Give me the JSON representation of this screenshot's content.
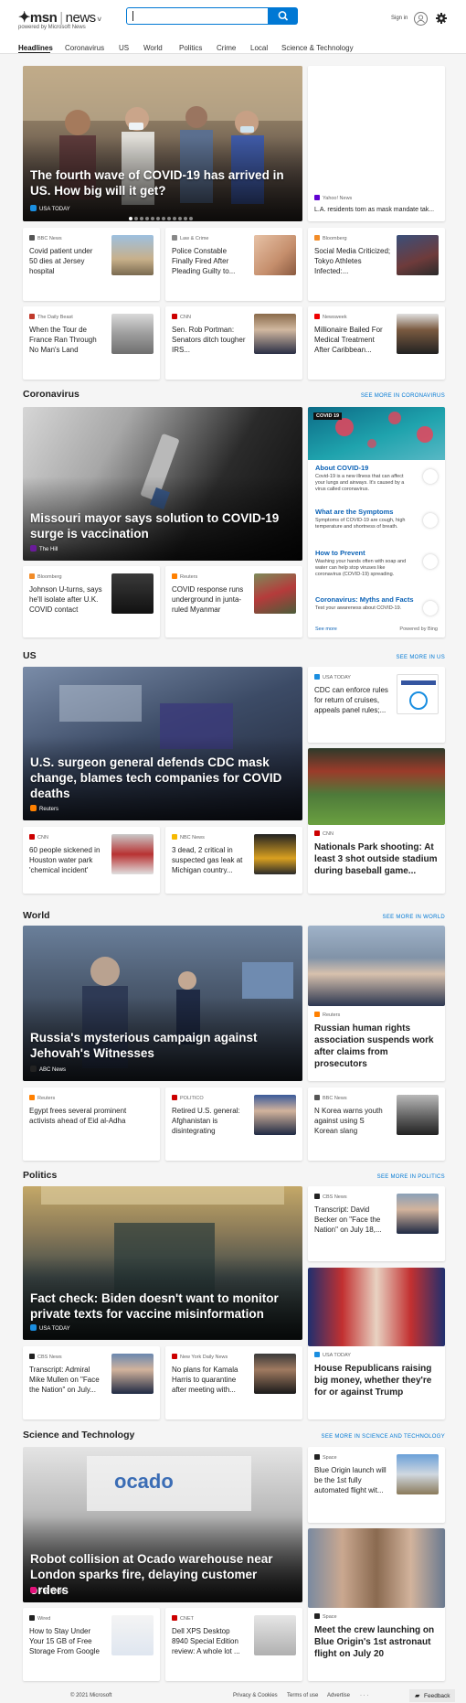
{
  "header": {
    "logo_msn": "msn",
    "logo_news": "news",
    "powered": "powered by Microsoft News",
    "search_value": "",
    "signin": "Sign in"
  },
  "nav": [
    "Headlines",
    "Coronavirus",
    "US",
    "World",
    "Politics",
    "Crime",
    "Local",
    "Science & Technology"
  ],
  "top": {
    "hero": {
      "title": "The fourth wave of COVID-19 has arrived in US. How big will it get?",
      "source": "USA TODAY"
    },
    "side": {
      "source": "Yahoo! News",
      "title": "L.A. residents torn as mask mandate tak..."
    },
    "row1": [
      {
        "source": "BBC News",
        "title": "Covid patient under 50 dies at Jersey hospital"
      },
      {
        "source": "Law & Crime",
        "title": "Police Constable Finally Fired After Pleading Guilty to..."
      },
      {
        "source": "Bloomberg",
        "title": "Social Media Criticized; Tokyo Athletes Infected:..."
      }
    ],
    "row2": [
      {
        "source": "The Daily Beast",
        "title": "When the Tour de France Ran Through No Man's Land"
      },
      {
        "source": "CNN",
        "title": "Sen. Rob Portman: Senators ditch tougher IRS..."
      },
      {
        "source": "Newsweek",
        "title": "Millionaire Bailed For Medical Treatment After Caribbean..."
      }
    ]
  },
  "coronavirus": {
    "heading": "Coronavirus",
    "more": "SEE MORE IN CORONAVIRUS",
    "hero": {
      "title": "Missouri mayor says solution to COVID-19 surge is vaccination",
      "source": "The Hill"
    },
    "row": [
      {
        "source": "Bloomberg",
        "title": "Johnson U-turns, says he'll isolate after U.K. COVID contact"
      },
      {
        "source": "Reuters",
        "title": "COVID response runs underground in junta-ruled Myanmar"
      }
    ],
    "panel": {
      "tag": "COVID 19",
      "items": [
        {
          "head": "About COVID-19",
          "desc": "Covid-19 is a new illness that can affect your lungs and airways. It's caused by a virus called coronavirus."
        },
        {
          "head": "What are the Symptoms",
          "desc": "Symptoms of COVID-19 are cough, high temperature and shortness of breath."
        },
        {
          "head": "How to Prevent",
          "desc": "Washing your hands often with soap and water can help stop viruses like coronavirus (COVID-19) spreading."
        },
        {
          "head": "Coronavirus: Myths and Facts",
          "desc": "Test your awareness about COVID-19."
        }
      ],
      "see_more": "See more",
      "powered": "Powered by Bing"
    }
  },
  "us": {
    "heading": "US",
    "more": "SEE MORE IN US",
    "hero": {
      "title": "U.S. surgeon general defends CDC mask change, blames tech companies for COVID deaths",
      "source": "Reuters"
    },
    "side": {
      "source": "USA TODAY",
      "title": "CDC can enforce rules for return of cruises, appeals panel rules;..."
    },
    "row": [
      {
        "source": "CNN",
        "title": "60 people sickened in Houston water park 'chemical incident'"
      },
      {
        "source": "NBC News",
        "title": "3 dead, 2 critical in suspected gas leak at Michigan country..."
      }
    ],
    "big": {
      "source": "CNN",
      "title": "Nationals Park shooting: At least 3 shot outside stadium during baseball game..."
    }
  },
  "world": {
    "heading": "World",
    "more": "SEE MORE IN WORLD",
    "hero": {
      "title": "Russia's mysterious campaign against Jehovah's Witnesses",
      "source": "ABC News"
    },
    "big": {
      "source": "Reuters",
      "title": "Russian human rights association suspends work after claims from prosecutors"
    },
    "row": [
      {
        "source": "Reuters",
        "title": "Egypt frees several prominent activists ahead of Eid al-Adha"
      },
      {
        "source": "POLITICO",
        "title": "Retired U.S. general: Afghanistan is disintegrating"
      },
      {
        "source": "BBC News",
        "title": "N Korea warns youth against using S Korean slang"
      }
    ]
  },
  "politics": {
    "heading": "Politics",
    "more": "SEE MORE IN POLITICS",
    "hero": {
      "title": "Fact check: Biden doesn't want to monitor private texts for vaccine misinformation",
      "source": "USA TODAY"
    },
    "side": {
      "source": "CBS News",
      "title": "Transcript: David Becker on \"Face the Nation\" on July 18,..."
    },
    "row": [
      {
        "source": "CBS News",
        "title": "Transcript: Admiral Mike Mullen on \"Face the Nation\" on July..."
      },
      {
        "source": "New York Daily News",
        "title": "No plans for Kamala Harris to quarantine after meeting with..."
      }
    ],
    "big": {
      "source": "USA TODAY",
      "title": "House Republicans raising big money, whether they're for or against Trump"
    }
  },
  "scitech": {
    "heading": "Science and Technology",
    "more": "SEE MORE IN SCIENCE AND TECHNOLOGY",
    "hero": {
      "title": "Robot collision at Ocado warehouse near London sparks fire, delaying customer orders",
      "source": "The Verge"
    },
    "side": {
      "source": "Space",
      "title": "Blue Origin launch will be the 1st fully automated flight wit..."
    },
    "row": [
      {
        "source": "Wired",
        "title": "How to Stay Under Your 15 GB of Free Storage From Google"
      },
      {
        "source": "CNET",
        "title": "Dell XPS Desktop 8940 Special Edition review: A whole lot ..."
      }
    ],
    "big": {
      "source": "Space",
      "title": "Meet the crew launching on Blue Origin's 1st astronaut flight on July 20"
    }
  },
  "footer": {
    "copyright": "© 2021 Microsoft",
    "privacy": "Privacy & Cookies",
    "terms": "Terms of use",
    "advertise": "Advertise",
    "more": "· · ·",
    "feedback": "Feedback"
  }
}
